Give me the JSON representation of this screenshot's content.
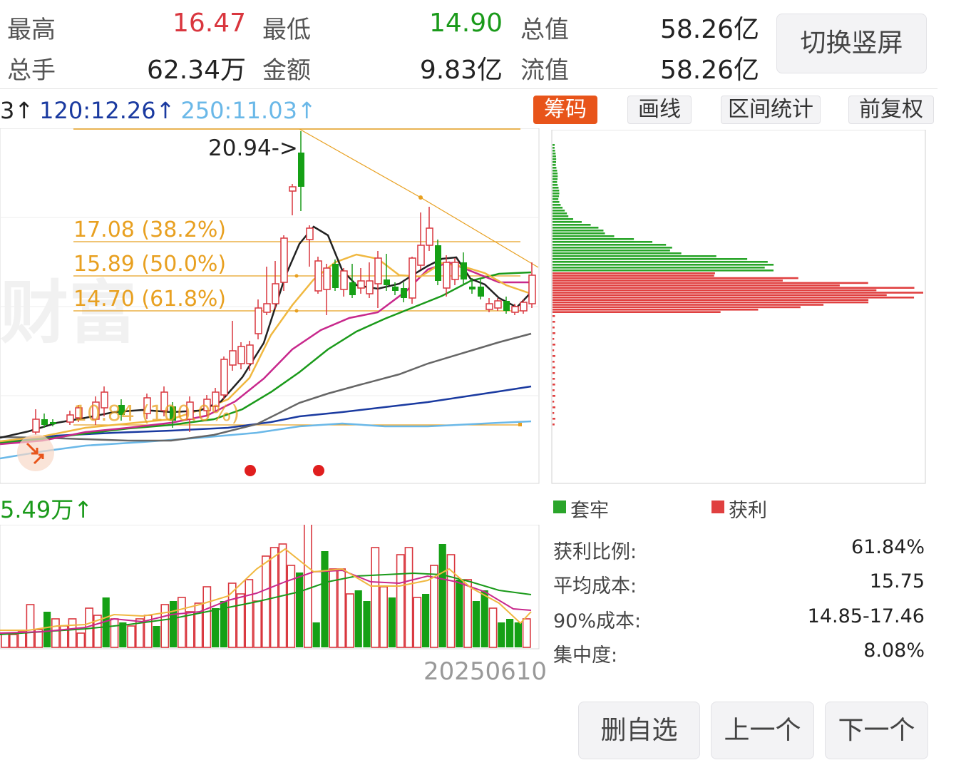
{
  "quote": {
    "high_label": "最高",
    "high_value": "16.47",
    "low_label": "最低",
    "low_value": "14.90",
    "total_value_label": "总值",
    "total_value": "58.26亿",
    "volume_label": "总手",
    "volume_value": "62.34万",
    "amount_label": "金额",
    "amount_value": "9.83亿",
    "float_value_label": "流值",
    "float_value": "58.26亿",
    "switch_button": "切换竖屏"
  },
  "ma_legend": {
    "partial": "3↑",
    "ma120": "120:12.26↑",
    "ma250": "250:11.03↑"
  },
  "tabs": {
    "chip": "筹码",
    "draw_line": "画线",
    "interval_stats": "区间统计",
    "adjust": "前复权"
  },
  "chart": {
    "peak_label": "20.94->",
    "fib_1": "17.08 (38.2%)",
    "fib_2": "15.89 (50.0%)",
    "fib_3": "14.70 (61.8%)",
    "fib_4": "10.84 (100.0%)",
    "watermark": "财富",
    "volume_label": "5.49万↑",
    "date_label": "20250610"
  },
  "colors": {
    "up": "#d9363e",
    "down": "#15a015",
    "fib": "#e8a020",
    "ma5": "#222222",
    "ma10": "#f0b840",
    "ma20": "#c8288c",
    "ma30": "#1a9a1a",
    "ma60": "#666666",
    "ma120": "#1a3aa0",
    "ma250": "#6ab8e8",
    "accent": "#e8541a"
  },
  "chip": {
    "legend_trapped": "套牢",
    "legend_profit": "获利",
    "profit_ratio_label": "获利比例:",
    "profit_ratio_value": "61.84%",
    "avg_cost_label": "平均成本:",
    "avg_cost_value": "15.75",
    "cost90_label": "90%成本:",
    "cost90_value": "14.85-17.46",
    "concentration_label": "集中度:",
    "concentration_value": "8.08%"
  },
  "actions": {
    "remove_watchlist": "删自选",
    "previous": "上一个",
    "next": "下一个"
  }
}
